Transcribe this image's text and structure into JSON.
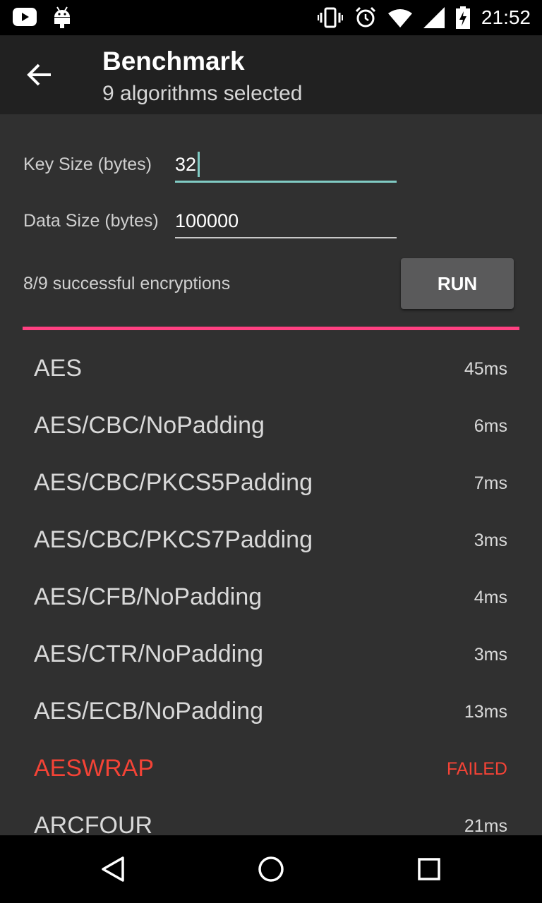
{
  "status_bar": {
    "time": "21:52",
    "icons": [
      "youtube-icon",
      "android-icon",
      "vibrate-icon",
      "alarm-icon",
      "wifi-icon",
      "signal-icon",
      "battery-charging-icon"
    ]
  },
  "app_bar": {
    "title": "Benchmark",
    "subtitle": "9 algorithms selected"
  },
  "form": {
    "key_size_label": "Key Size (bytes)",
    "key_size_value": "32",
    "data_size_label": "Data Size (bytes)",
    "data_size_value": "100000"
  },
  "summary": "8/9 successful encryptions",
  "run_label": "RUN",
  "progress": 1.0,
  "colors": {
    "accent": "#ff4081",
    "teal": "#80cbc4",
    "error": "#f44336",
    "background": "#303030",
    "toolbar": "#212121"
  },
  "results": [
    {
      "name": "AES",
      "time": "45ms",
      "failed": false
    },
    {
      "name": "AES/CBC/NoPadding",
      "time": "6ms",
      "failed": false
    },
    {
      "name": "AES/CBC/PKCS5Padding",
      "time": "7ms",
      "failed": false
    },
    {
      "name": "AES/CBC/PKCS7Padding",
      "time": "3ms",
      "failed": false
    },
    {
      "name": "AES/CFB/NoPadding",
      "time": "4ms",
      "failed": false
    },
    {
      "name": "AES/CTR/NoPadding",
      "time": "3ms",
      "failed": false
    },
    {
      "name": "AES/ECB/NoPadding",
      "time": "13ms",
      "failed": false
    },
    {
      "name": "AESWRAP",
      "time": "FAILED",
      "failed": true
    },
    {
      "name": "ARCFOUR",
      "time": "21ms",
      "failed": false
    }
  ]
}
